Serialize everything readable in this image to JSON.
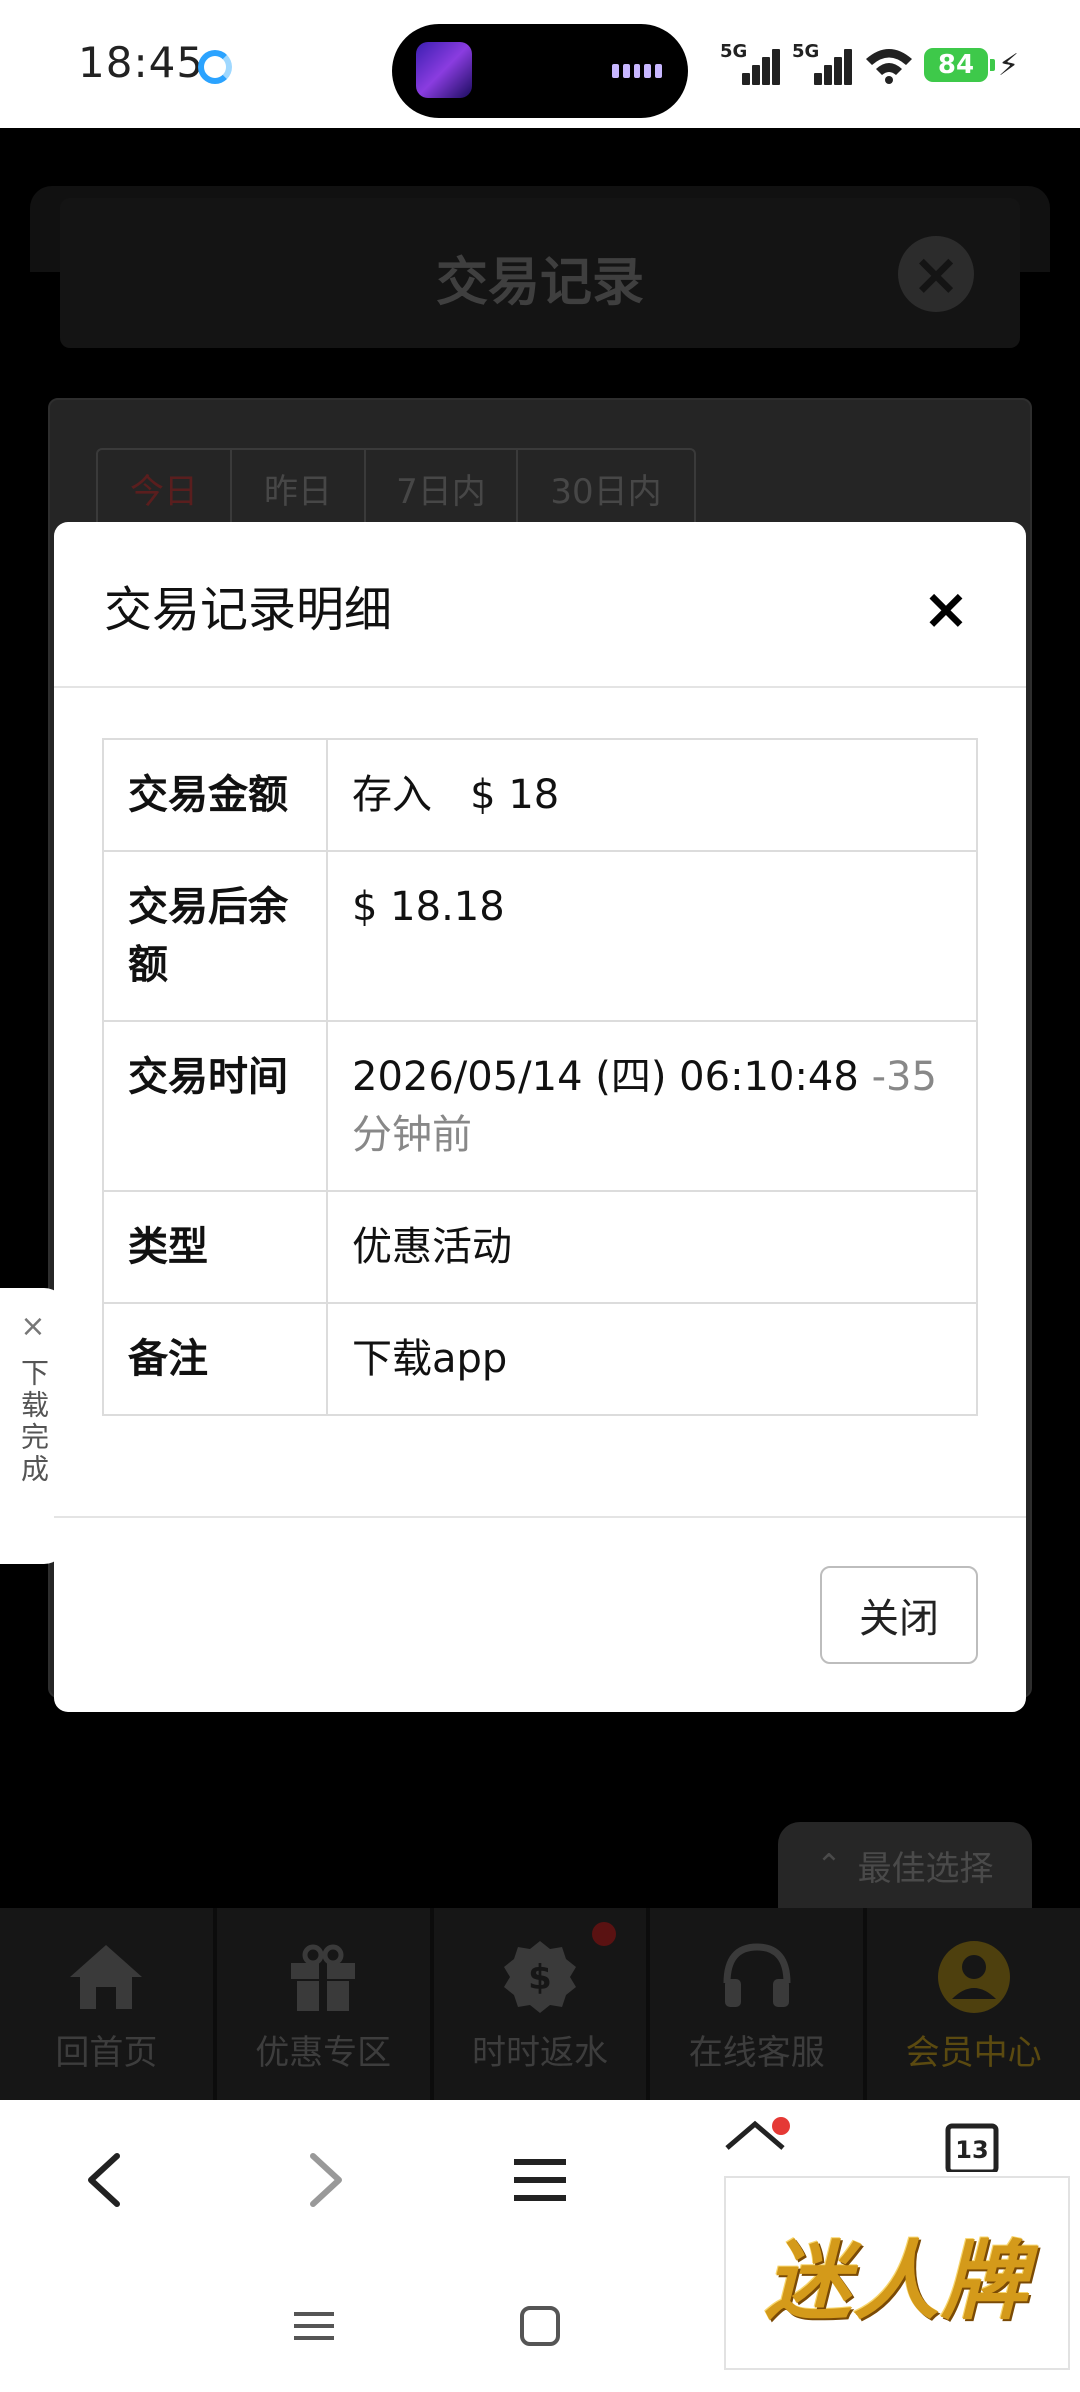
{
  "status_bar": {
    "time": "18:45",
    "signal1": "5G",
    "signal2": "5G",
    "battery": "84"
  },
  "background_page": {
    "title": "交易记录",
    "tabs": [
      {
        "label": "今日",
        "active": true
      },
      {
        "label": "昨日",
        "active": false
      },
      {
        "label": "7日内",
        "active": false
      },
      {
        "label": "30日内",
        "active": false
      }
    ],
    "best_choice": "最佳选择",
    "bottom_nav": [
      {
        "label": "回首页",
        "icon": "home-icon"
      },
      {
        "label": "优惠专区",
        "icon": "gift-icon"
      },
      {
        "label": "时时返水",
        "icon": "dollar-badge-icon"
      },
      {
        "label": "在线客服",
        "icon": "headset-icon"
      },
      {
        "label": "会员中心",
        "icon": "user-icon"
      }
    ]
  },
  "side_download": {
    "close": "×",
    "label": "下载完成"
  },
  "modal": {
    "title": "交易记录明细",
    "close_icon": "×",
    "rows": {
      "amount": {
        "label": "交易金额",
        "direction": "存入",
        "value": "$ 18"
      },
      "balance": {
        "label": "交易后余额",
        "value": "$ 18.18"
      },
      "time": {
        "label": "交易时间",
        "value": "2026/05/14 (四) 06:10:48",
        "relative": "-35分钟前"
      },
      "type": {
        "label": "类型",
        "value": "优惠活动"
      },
      "note": {
        "label": "备注",
        "value": "下载app"
      }
    },
    "close_button": "关闭"
  },
  "browser_bar": {
    "icons": [
      "back-icon",
      "forward-icon",
      "menu-icon",
      "home-icon",
      "tabs-icon"
    ],
    "tab_count": "13",
    "system_nav": [
      "recents-icon",
      "home-square-icon"
    ]
  },
  "watermark_logo": "迷人牌",
  "colors": {
    "deposit_green": "#2f6b2f",
    "battery_green": "#3ec94a",
    "dim_bg": "#000000"
  }
}
